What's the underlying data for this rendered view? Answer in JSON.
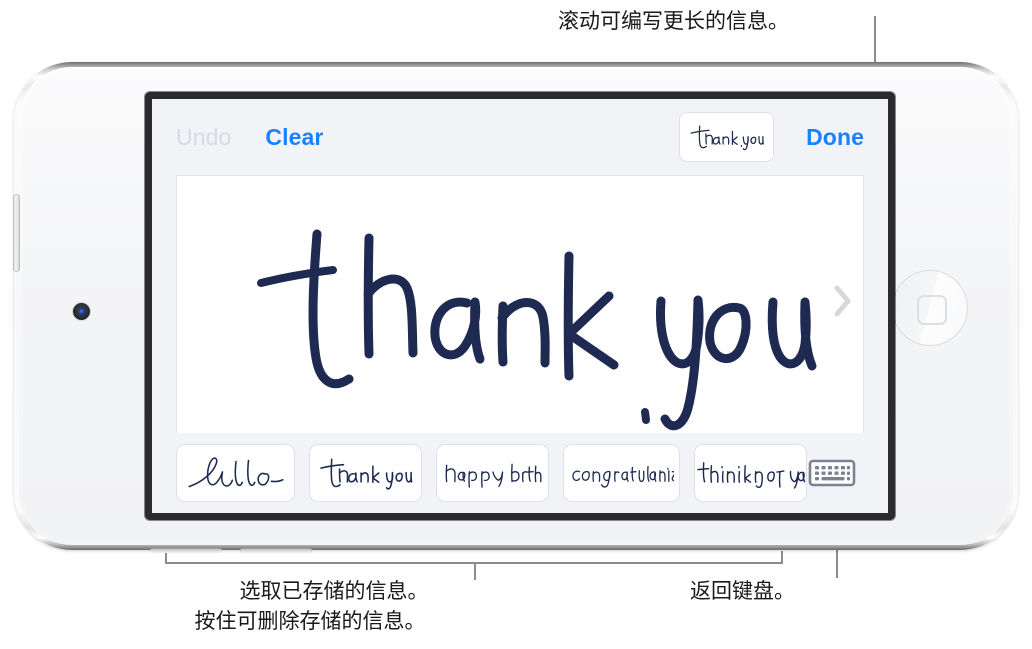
{
  "annotations": {
    "top_right": "滚动可编写更长的信息。",
    "bottom_left_line1": "选取已存储的信息。",
    "bottom_left_line2": "按住可删除存储的信息。",
    "bottom_right": "返回键盘。"
  },
  "device": {
    "type": "ipod-touch",
    "home_button_label": "Home",
    "camera_label": "Front camera",
    "side_button_label": "Volume button"
  },
  "screen": {
    "toolbar": {
      "undo_label": "Undo",
      "undo_enabled": false,
      "clear_label": "Clear",
      "done_label": "Done",
      "preview_text": "thank you"
    },
    "canvas": {
      "handwriting_text": "thank you",
      "ink_color": "#1f2a52",
      "background": "#ffffff",
      "scroll_chevron_icon": "chevron-right-icon",
      "chevron_color": "#d8d8d8"
    },
    "suggestions": {
      "items": [
        {
          "text": "hello"
        },
        {
          "text": "thank you"
        },
        {
          "text": "happy birthday"
        },
        {
          "text": "congratulations"
        },
        {
          "text": "thinking of you"
        }
      ],
      "keyboard_button_icon": "keyboard-icon"
    }
  },
  "colors": {
    "accent_blue": "#1a82ff",
    "disabled_gray": "#d7dae0",
    "chrome_bar": "#f2f3f7",
    "ink": "#1f2a52",
    "leader_line": "#8c8c8c",
    "bezel": "#2b2b2d"
  }
}
